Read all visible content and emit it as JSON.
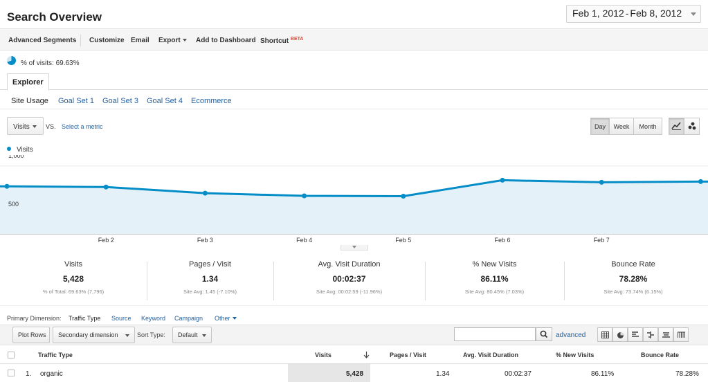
{
  "header": {
    "title": "Search Overview",
    "date_start": "Feb 1, 2012",
    "date_sep": "-",
    "date_end": "Feb 8, 2012"
  },
  "toolbar": {
    "advanced_segments": "Advanced Segments",
    "customize": "Customize",
    "email": "Email",
    "export": "Export",
    "add_to_dashboard": "Add to Dashboard",
    "shortcut": "Shortcut",
    "beta": "BETA"
  },
  "segment": {
    "label": "% of visits: 69.63%",
    "share": 0.6963
  },
  "explorer_tab": "Explorer",
  "subtabs": [
    "Site Usage",
    "Goal Set 1",
    "Goal Set 3",
    "Goal Set 4",
    "Ecommerce"
  ],
  "chart_controls": {
    "metric": "Visits",
    "vs": "VS.",
    "select_metric": "Select a metric",
    "day": "Day",
    "week": "Week",
    "month": "Month",
    "active_period": "Day"
  },
  "chart_data": {
    "type": "area",
    "series": [
      {
        "name": "Visits",
        "color": "#058dc7",
        "values": [
          700,
          690,
          600,
          560,
          555,
          790,
          760,
          770
        ]
      }
    ],
    "x": [
      "Feb 1",
      "Feb 2",
      "Feb 3",
      "Feb 4",
      "Feb 5",
      "Feb 6",
      "Feb 7",
      "Feb 8"
    ],
    "x_tick_labels": [
      "Feb 2",
      "Feb 3",
      "Feb 4",
      "Feb 5",
      "Feb 6",
      "Feb 7"
    ],
    "y_tick_labels": [
      "1,000",
      "500"
    ],
    "ylim": [
      0,
      1100
    ],
    "grid": true,
    "legend": "top-left"
  },
  "scorecards": [
    {
      "label": "Visits",
      "value": "5,428",
      "sub": "% of Total: 69.63% (7,796)"
    },
    {
      "label": "Pages / Visit",
      "value": "1.34",
      "sub": "Site Avg: 1.45 (-7.10%)"
    },
    {
      "label": "Avg. Visit Duration",
      "value": "00:02:37",
      "sub": "Site Avg: 00:02:59 (-11.96%)"
    },
    {
      "label": "% New Visits",
      "value": "86.11%",
      "sub": "Site Avg: 80.45% (7.03%)"
    },
    {
      "label": "Bounce Rate",
      "value": "78.28%",
      "sub": "Site Avg: 73.74% (6.15%)"
    }
  ],
  "dimensions": {
    "label": "Primary Dimension:",
    "active": "Traffic Type",
    "others": [
      "Source",
      "Keyword",
      "Campaign"
    ],
    "other": "Other"
  },
  "table_controls": {
    "plot_rows": "Plot Rows",
    "secondary_dimension": "Secondary dimension",
    "sort_type_label": "Sort Type:",
    "sort_type": "Default",
    "search_value": "",
    "advanced": "advanced"
  },
  "table": {
    "columns": [
      "Traffic Type",
      "Visits",
      "Pages / Visit",
      "Avg. Visit Duration",
      "% New Visits",
      "Bounce Rate"
    ],
    "rows": [
      {
        "index": "1.",
        "traffic_type": "organic",
        "visits": "5,428",
        "pages_per_visit": "1.34",
        "avg_duration": "00:02:37",
        "new_visits": "86.11%",
        "bounce_rate": "78.28%"
      }
    ]
  }
}
